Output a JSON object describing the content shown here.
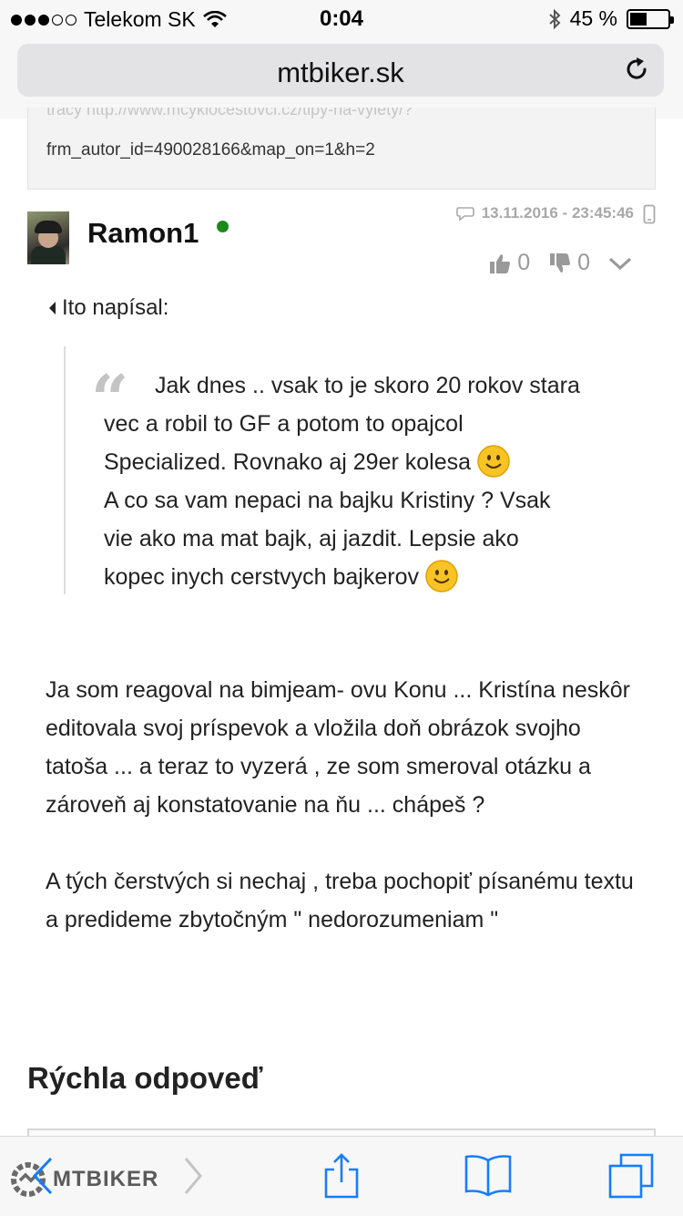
{
  "status_bar": {
    "carrier": "Telekom SK",
    "time": "0:04",
    "battery": "45 %",
    "battery_level": 0.45,
    "signal_bars_filled": 3,
    "signal_bars_total": 5
  },
  "browser": {
    "url": "mtbiker.sk"
  },
  "previous_post": {
    "url_clipped": "tracy http://www.mcyklocestovci.cz/tipy-na-vylety/?",
    "url_tail": "frm_autor_id=490028166&map_on=1&h=2"
  },
  "post": {
    "username": "Ramon1",
    "timestamp": "13.11.2016 - 23:45:46",
    "likes": "0",
    "dislikes": "0",
    "quote_author": "Ito napísal:",
    "quote_mark": "“",
    "quote_lines": [
      "Jak dnes .. vsak to je skoro 20 rokov stara",
      "vec a robil to GF a potom to opajcol",
      "Specialized. Rovnako aj 29er kolesa",
      "A co sa vam nepaci na bajku Kristiny ? Vsak",
      "vie ako ma mat bajk, aj jazdit. Lepsie ako",
      "kopec inych cerstvych bajkerov"
    ],
    "reply_paragraph_1": "Ja som reagoval na bimjeam- ovu Konu ... Kristína neskôr editovala svoj príspevok a vložila doň obrázok svojho tatoša ... a teraz to vyzerá , ze som smeroval otázku a zároveň aj konstatovanie na ňu ... chápeš ?",
    "reply_paragraph_2": "A tých čerstvých si nechaj , treba pochopiť písanému textu a predideme zbytočným \" nedorozumeniam \""
  },
  "quick_reply": {
    "title": "Rýchla odpoveď"
  },
  "watermark": {
    "logo_text": "MTBIKER"
  },
  "colors": {
    "ios_blue": "#157efb",
    "online_green": "#1a8a1a",
    "muted_gray": "#a8a8a8"
  }
}
